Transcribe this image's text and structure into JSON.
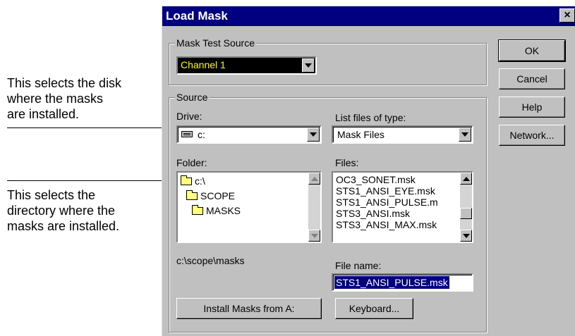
{
  "callouts": {
    "drive_note": [
      "This selects the disk",
      "where the masks",
      "are installed."
    ],
    "folder_note": [
      "This selects the",
      "directory where the",
      "masks are installed."
    ]
  },
  "dialog": {
    "title": "Load Mask",
    "close_glyph": "×",
    "mask_test_source": {
      "legend": "Mask Test Source",
      "value": "Channel 1",
      "value_color": "#ffff00"
    },
    "source": {
      "legend": "Source",
      "drive_label": "Drive:",
      "drive_value": "c:",
      "list_type_label": "List files of type:",
      "list_type_value": "Mask Files",
      "folder_label": "Folder:",
      "folders": [
        "c:\\",
        "SCOPE",
        "MASKS"
      ],
      "files_label": "Files:",
      "files": [
        "OC3_SONET.msk",
        "STS1_ANSI_EYE.msk",
        "STS1_ANSI_PULSE.m",
        "STS3_ANSI.msk",
        "STS3_ANSI_MAX.msk"
      ],
      "current_path": "c:\\scope\\masks",
      "file_name_label": "File name:",
      "file_name_value": "STS1_ANSI_PULSE.msk",
      "install_button": "Install Masks from A:",
      "keyboard_button": "Keyboard..."
    },
    "buttons": {
      "ok": "OK",
      "cancel": "Cancel",
      "help": "Help",
      "network": "Network..."
    },
    "icons": {
      "drive": "hard-drive-icon",
      "folder_open": "folder-open-icon"
    }
  }
}
